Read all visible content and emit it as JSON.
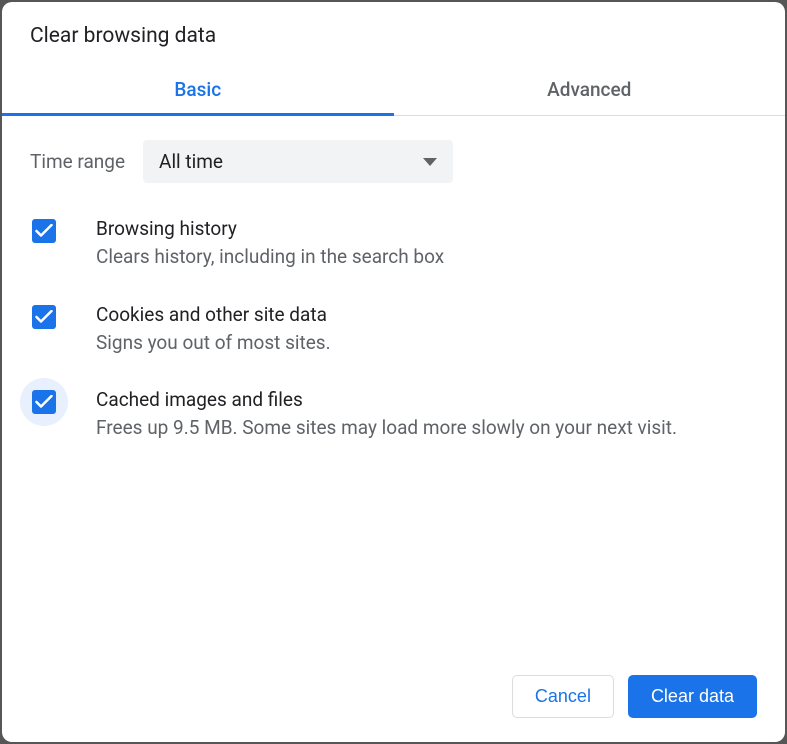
{
  "dialog": {
    "title": "Clear browsing data"
  },
  "tabs": {
    "basic": "Basic",
    "advanced": "Advanced"
  },
  "timeRange": {
    "label": "Time range",
    "value": "All time"
  },
  "options": {
    "browsingHistory": {
      "title": "Browsing history",
      "desc": "Clears history, including in the search box"
    },
    "cookies": {
      "title": "Cookies and other site data",
      "desc": "Signs you out of most sites."
    },
    "cache": {
      "title": "Cached images and files",
      "desc": "Frees up 9.5 MB. Some sites may load more slowly on your next visit."
    }
  },
  "buttons": {
    "cancel": "Cancel",
    "clear": "Clear data"
  }
}
